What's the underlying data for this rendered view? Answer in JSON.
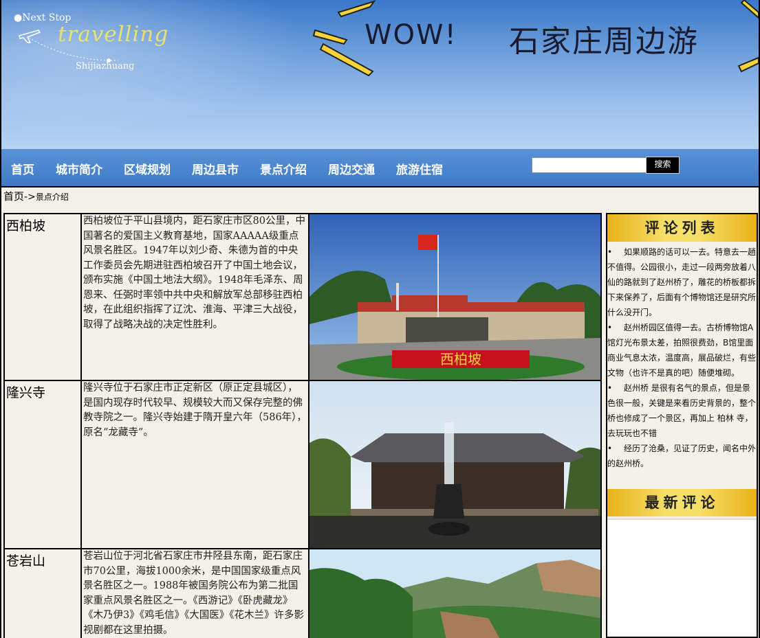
{
  "banner": {
    "logo_top": "●Next Stop",
    "logo_script": "travelling",
    "logo_city": "Shijiazhuang",
    "wow": "WOW!",
    "headline": "石家庄周边游"
  },
  "nav": {
    "items": [
      "首页",
      "城市简介",
      "区域规划",
      "周边县市",
      "景点介绍",
      "周边交通",
      "旅游住宿"
    ],
    "search_placeholder": "",
    "search_button": "搜索"
  },
  "breadcrumb": {
    "home": "首页",
    "separator": "->",
    "current": "景点介绍"
  },
  "spots": [
    {
      "name": "西柏坡",
      "description": "西柏坡位于平山县境内，距石家庄市区80公里，中国著名的爱国主义教育基地，国家AAAAA级重点风景名胜区。1947年以刘少奇、朱德为首的中央工作委员会先期进驻西柏坡召开了中国土地会议，颁布实施《中国土地法大纲》。1948年毛泽东、周恩来、任弼时率领中共中央和解放军总部移驻西柏坡，在此组织指挥了辽沈、淮海、平津三大战役，取得了战略决战的决定性胜利。",
      "photo_sign": "西柏坡"
    },
    {
      "name": "隆兴寺",
      "description": "隆兴寺位于石家庄市正定新区（原正定县城区），是国内现存时代较早、规模较大而又保存完整的佛教寺院之一。隆兴寺始建于隋开皇六年（586年），原名“龙藏寺”。",
      "photo_sign": ""
    },
    {
      "name": "苍岩山",
      "description": "苍岩山位于河北省石家庄市井陉县东南，距石家庄市70公里，海拔1000余米，是中国国家级重点风景名胜区之一。1988年被国务院公布为第二批国家重点风景名胜区之一。《西游记》《卧虎藏龙》《木乃伊3》《鸡毛信》《大国医》《花木兰》许多影视剧都在这里拍摄。",
      "photo_sign": ""
    }
  ],
  "sidebar": {
    "comments_title": "评论列表",
    "comments": [
      "如果顺路的话可以一去。特意去一趟不值得。公园很小，走过一段两旁放着八仙的路就到了赵州桥了，雕花的桥板都拆下来保养了，后面有个博物馆还是研究所什么没开门。",
      "赵州桥园区值得一去。古桥博物馆A馆灯光布景太差，拍照很费劲，B馆里面商业气息太浓，温度高，展品破烂，有些文物（也许不是真的吧）随便堆砌。",
      "赵州桥 是很有名气的景点，但是景色很一般，关键是来看历史背景的，整个桥也修成了一个景区，再加上 柏林 寺，去玩玩也不错",
      "经历了沧桑，见证了历史，闻名中外的赵州桥。"
    ],
    "latest_title": "最新评论"
  },
  "colors": {
    "banner_top": "#3a78c9",
    "nav_bg": "#4a86d0",
    "title_bar": "#f6e06a",
    "page_bg": "#f4f1e8"
  }
}
